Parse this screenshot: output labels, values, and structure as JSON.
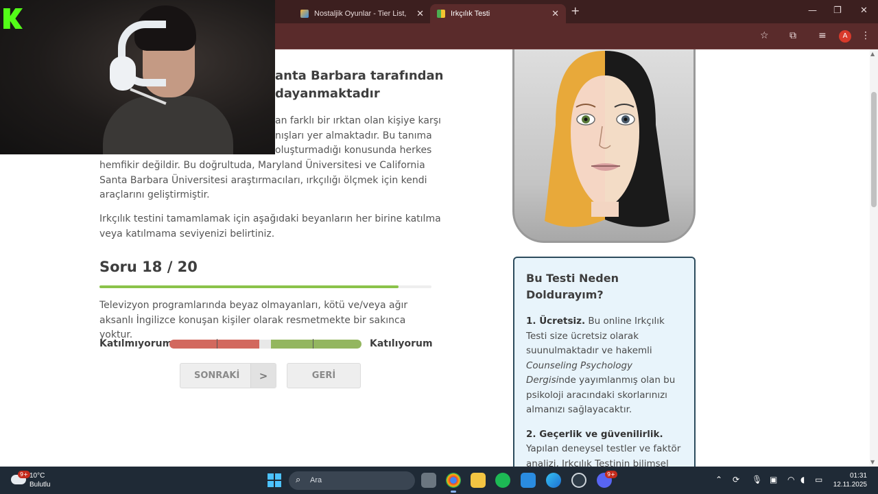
{
  "browser": {
    "tabs": [
      {
        "title": "Nostaljik Oyunlar - Tier List, Kör",
        "close": "✕"
      },
      {
        "title": "Irkçılık Testi",
        "close": "✕"
      }
    ],
    "new_tab": "+",
    "window_controls": {
      "minimize": "—",
      "maximize": "❐",
      "close": "✕"
    },
    "profile_initial": "A"
  },
  "page": {
    "intro_heading_fragment": [
      "anta Barbara tarafından",
      "dayanmaktadır"
    ],
    "intro_paragraph_fragment": [
      "an farklı bir ırktan olan kişiye karşı",
      "nışları yer almaktadır. Bu tanıma",
      "oluşturmadığı konusunda herkes"
    ],
    "intro_paragraph_lines": [
      "hemfikir değildir. Bu doğrultuda, Maryland Üniversitesi ve California",
      "Santa Barbara Üniversitesi araştırmacıları, ırkçılığı ölçmek için kendi",
      "araçlarını geliştirmiştir."
    ],
    "instruction_lines": [
      "Irkçılık testini tamamlamak için aşağıdaki beyanların her birine katılma",
      "veya katılmama seviyenizi belirtiniz."
    ],
    "question_counter": "Soru 18 / 20",
    "progress_fraction": 0.9,
    "question_text": "Televizyon programlarında beyaz olmayanları, kötü ve/veya ağır aksanlı İngilizce konuşan kişiler olarak resmetmekte bir sakınca yoktur.",
    "scale": {
      "left_label": "Katılmıyorum",
      "right_label": "Katılıyorum"
    },
    "buttons": {
      "next": "SONRAKİ",
      "next_arrow": ">",
      "back": "GERİ"
    }
  },
  "sidebar_card": {
    "title": "Bu Testi Neden Doldurayım?",
    "item1_bold": "1. Ücretsiz.",
    "item1_text_a": " Bu online Irkçılık Testi size ücretsiz olarak suunulmaktadır ve hakemli ",
    "item1_italic": "Counseling Psychology Dergisi",
    "item1_text_b": "nde yayımlanmış olan bu psikoloji aracındaki skorlarınızı almanızı sağlayacaktır.",
    "item2_bold": "2. Geçerlik ve güvenilirlik.",
    "item2_text": "Yapılan deneysel testler ve faktör analizi, Irkçılık Testinin bilimsel"
  },
  "taskbar": {
    "weather_temp": "10°C",
    "weather_desc": "Bulutlu",
    "weather_badge": "9+",
    "search_placeholder": "Ara",
    "discord_badge": "9+",
    "time": "01:31",
    "date": "12.11.2025"
  },
  "colors": {
    "tab_strip": "#3c1f1f",
    "address_bar": "#5a2b2b",
    "progress": "#8bc34a",
    "disagree": "#d2685e",
    "agree": "#93b65f",
    "card_border": "#2c4b5c",
    "card_bg": "#e8f4fb",
    "kick_green": "#53fc18"
  }
}
